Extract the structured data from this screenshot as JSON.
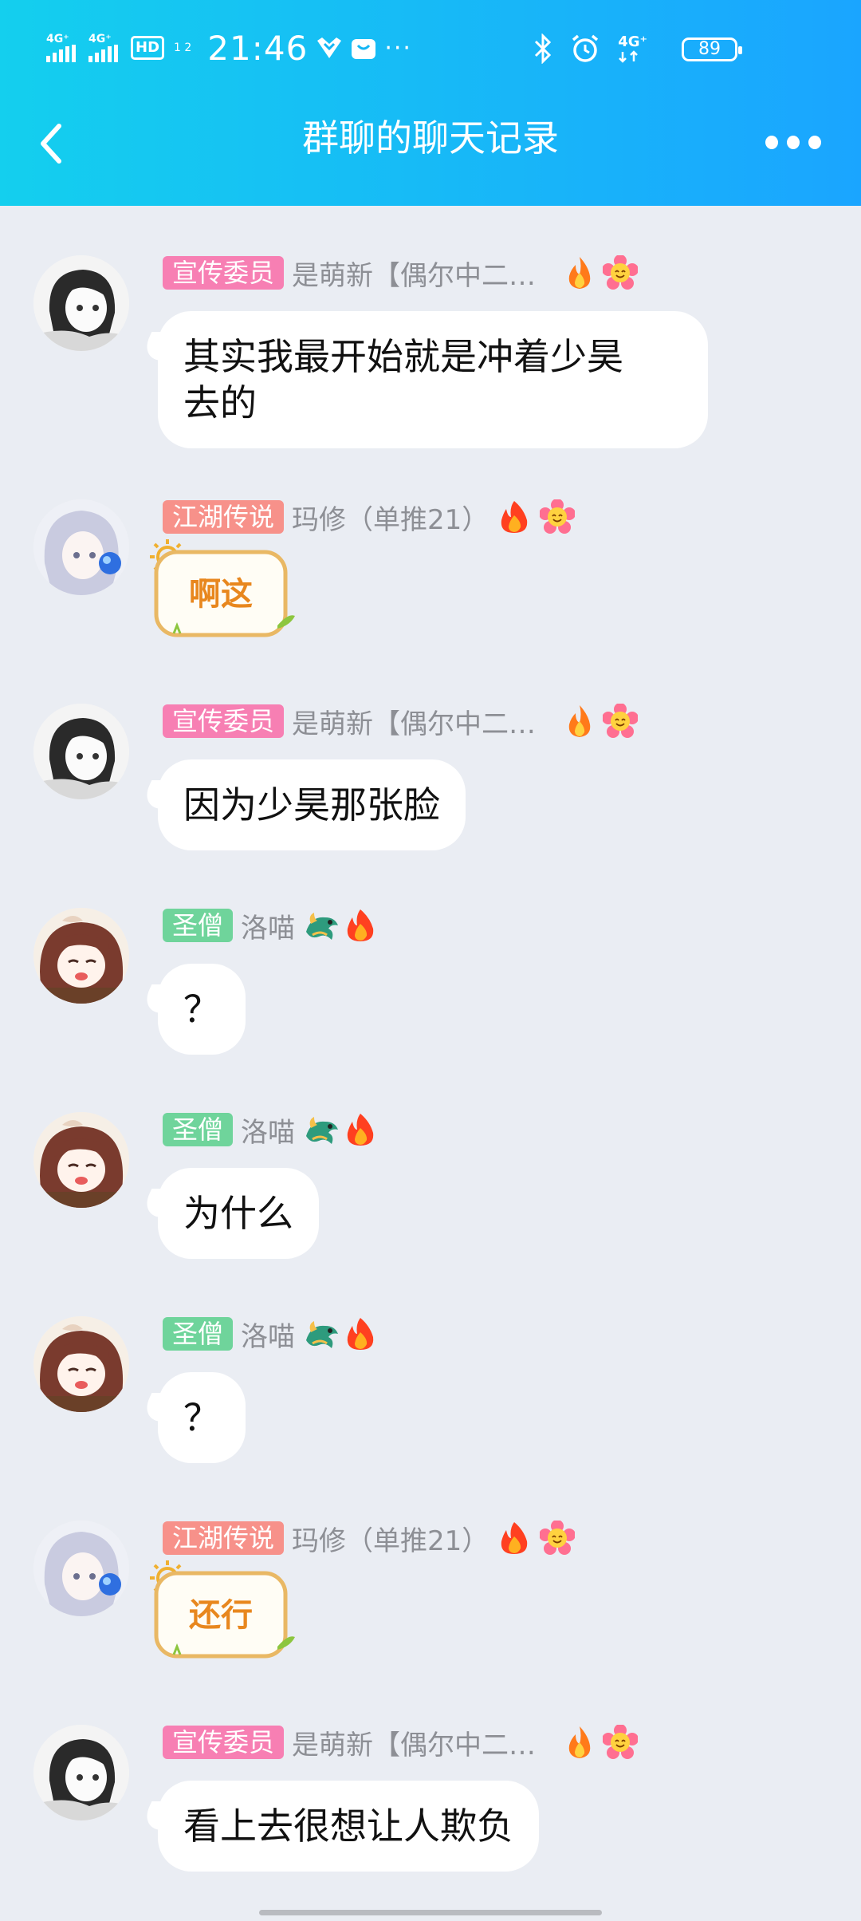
{
  "status_bar": {
    "network_1": "4G⁺",
    "network_2": "4G⁺",
    "hd_label": "HD",
    "hd_sub": "1 2",
    "time": "21:46",
    "more": "···",
    "right_network": "4G⁺",
    "battery": "89"
  },
  "nav": {
    "title": "群聊的聊天记录"
  },
  "colors": {
    "header_from": "#14cfee",
    "header_to": "#1aa5ff",
    "background": "#eaedf3",
    "badge_pink": "#f77fb3",
    "badge_salmon": "#f7918a",
    "badge_green": "#6fd49b"
  },
  "messages": [
    {
      "badge": "宣传委员",
      "badge_color": "#f77fb3",
      "nick": "是萌新【偶尔中二…",
      "avatar": "girl-bw-avatar",
      "icons": [
        "fire-icon",
        "flower-icon"
      ],
      "text": "其实我最开始就是冲着少昊\n去的"
    },
    {
      "badge": "江湖传说",
      "badge_color": "#f7918a",
      "nick": "玛修（单推21）",
      "avatar": "white-hair-avatar",
      "icons": [
        "flame-red-icon",
        "flower-icon"
      ],
      "sticker": "啊这"
    },
    {
      "badge": "宣传委员",
      "badge_color": "#f77fb3",
      "nick": "是萌新【偶尔中二…",
      "avatar": "girl-bw-avatar",
      "icons": [
        "fire-icon",
        "flower-icon"
      ],
      "text": "因为少昊那张脸"
    },
    {
      "badge": "圣僧",
      "badge_color": "#6fd49b",
      "nick": "洛喵",
      "avatar": "brown-hair-avatar",
      "icons": [
        "dragon-icon",
        "flame-red-icon"
      ],
      "text": "？"
    },
    {
      "badge": "圣僧",
      "badge_color": "#6fd49b",
      "nick": "洛喵",
      "avatar": "brown-hair-avatar",
      "icons": [
        "dragon-icon",
        "flame-red-icon"
      ],
      "text": "为什么"
    },
    {
      "badge": "圣僧",
      "badge_color": "#6fd49b",
      "nick": "洛喵",
      "avatar": "brown-hair-avatar",
      "icons": [
        "dragon-icon",
        "flame-red-icon"
      ],
      "text": "？"
    },
    {
      "badge": "江湖传说",
      "badge_color": "#f7918a",
      "nick": "玛修（单推21）",
      "avatar": "white-hair-avatar",
      "icons": [
        "flame-red-icon",
        "flower-icon"
      ],
      "sticker": "还行"
    },
    {
      "badge": "宣传委员",
      "badge_color": "#f77fb3",
      "nick": "是萌新【偶尔中二…",
      "avatar": "girl-bw-avatar",
      "icons": [
        "fire-icon",
        "flower-icon"
      ],
      "text": "看上去很想让人欺负"
    }
  ]
}
